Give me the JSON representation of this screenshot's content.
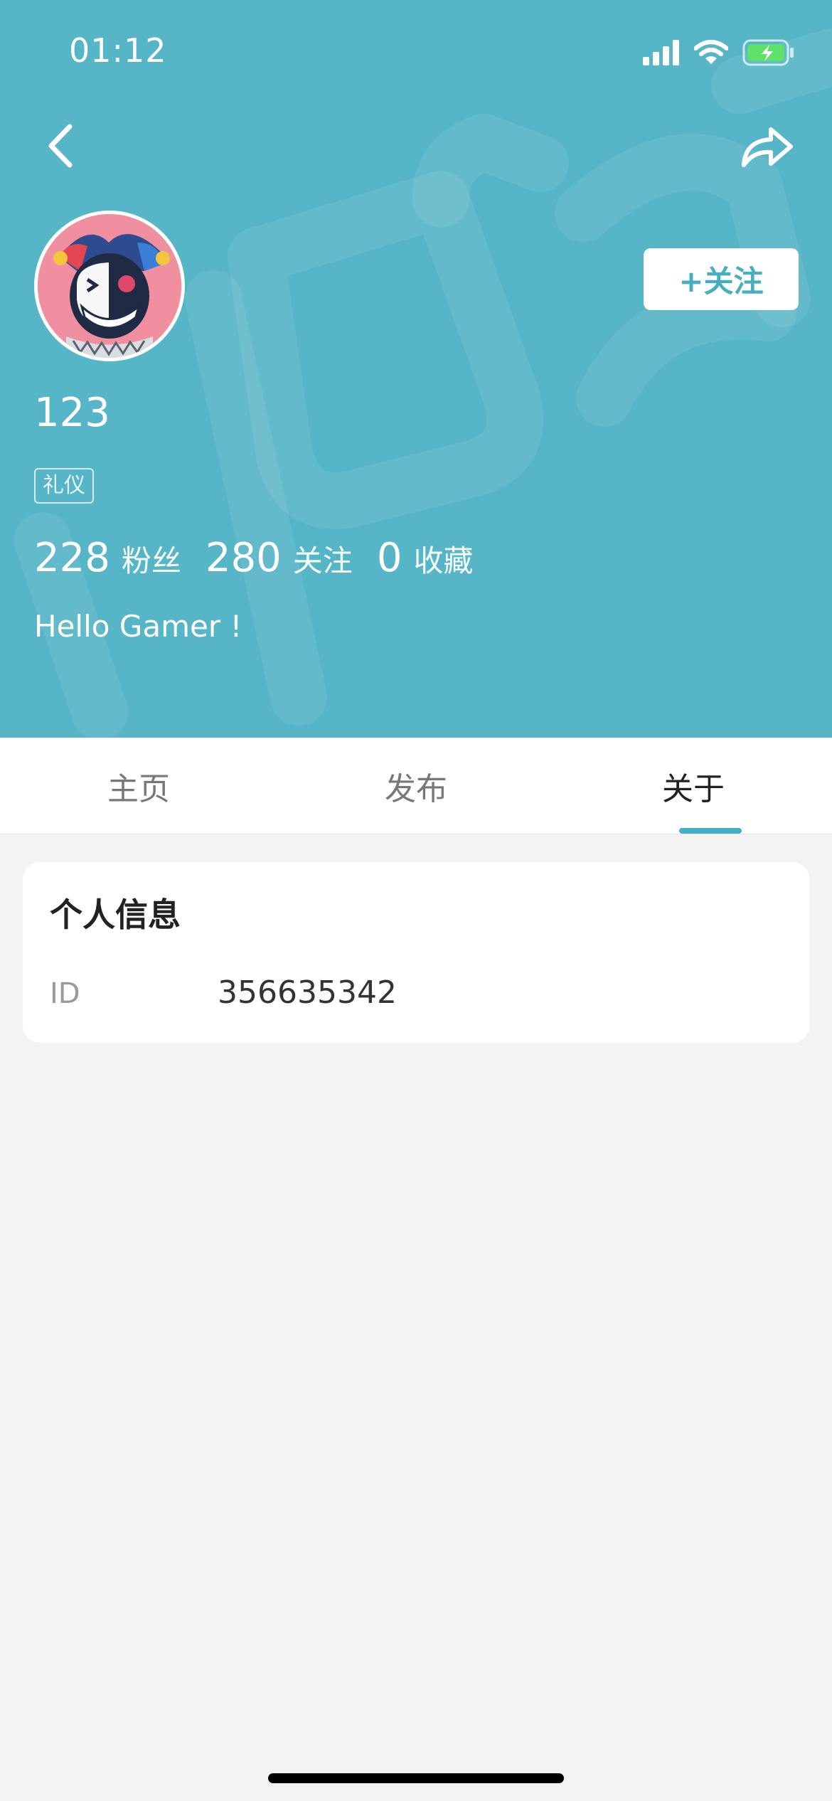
{
  "status_bar": {
    "time": "01:12"
  },
  "profile": {
    "username": "123",
    "tag": "礼仪",
    "bio": "Hello Gamer !",
    "follow_label": "+关注",
    "stats": [
      {
        "value": "228",
        "label": "粉丝"
      },
      {
        "value": "280",
        "label": "关注"
      },
      {
        "value": "0",
        "label": "收藏"
      }
    ]
  },
  "tabs": [
    {
      "label": "主页"
    },
    {
      "label": "发布"
    },
    {
      "label": "关于"
    }
  ],
  "about_card": {
    "title": "个人信息",
    "id_label": "ID",
    "id_value": "356635342"
  },
  "colors": {
    "header": "#56b5c7",
    "accent": "#47aebf",
    "background": "#f3f3f3"
  }
}
